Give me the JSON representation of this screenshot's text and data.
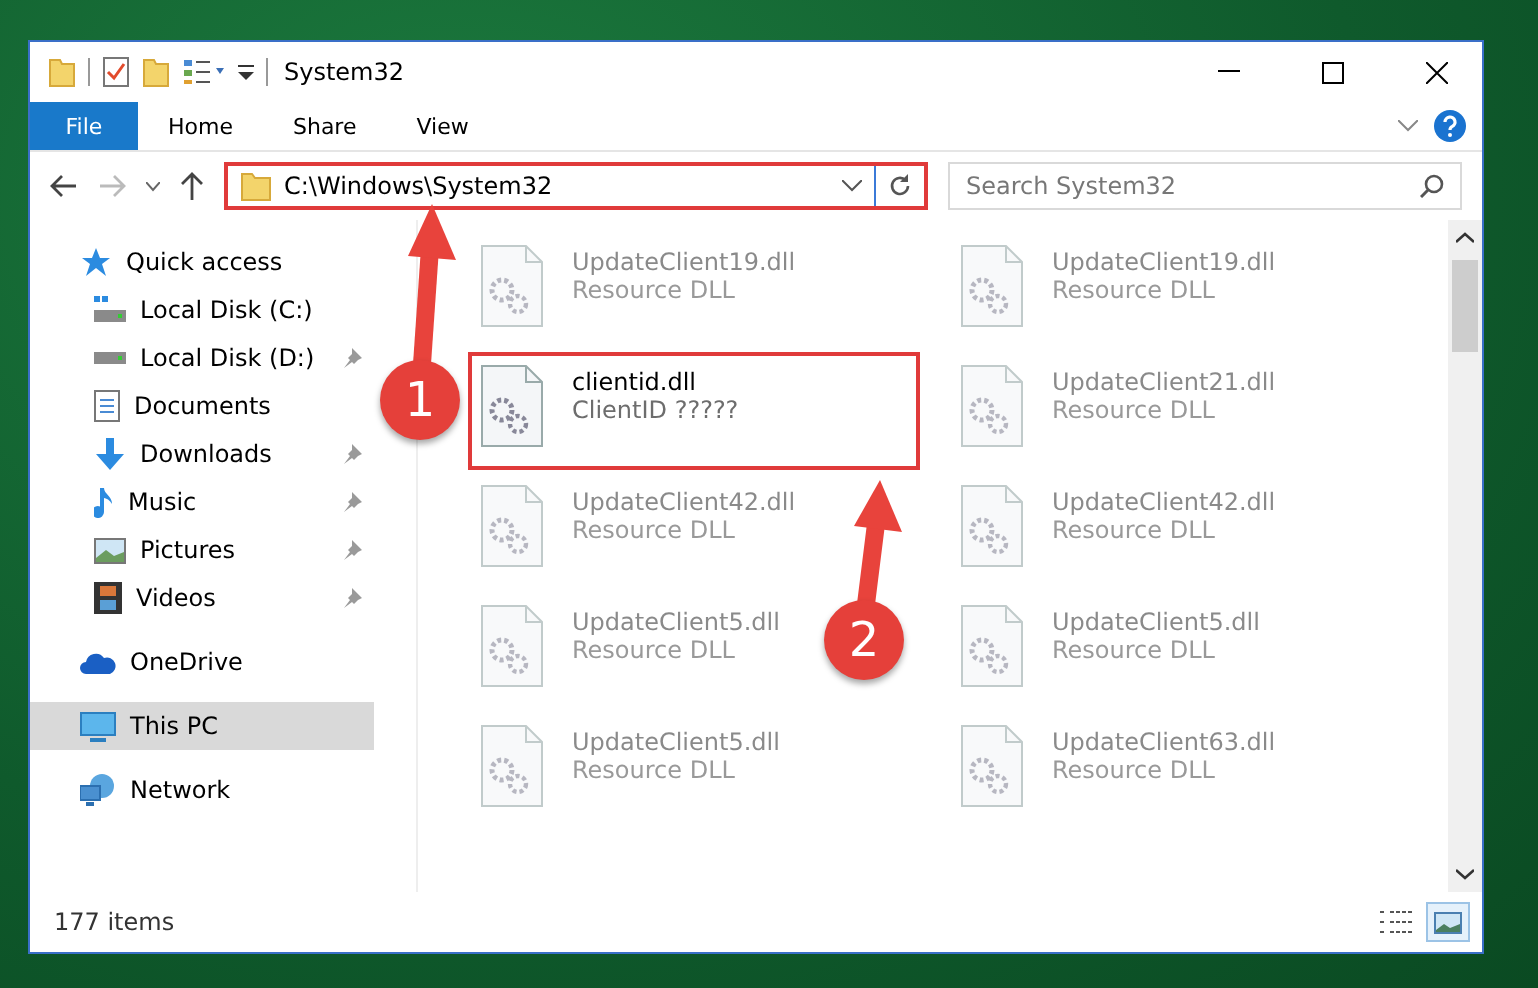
{
  "window": {
    "title": "System32"
  },
  "ribbon_tabs": [
    {
      "label": "File",
      "kind": "file",
      "selected": false
    },
    {
      "label": "Home",
      "kind": "tab",
      "selected": false
    },
    {
      "label": "Share",
      "kind": "tab",
      "selected": false
    },
    {
      "label": "View",
      "kind": "tab",
      "selected": false
    }
  ],
  "address_bar": {
    "path": "C:\\Windows\\System32",
    "highlighted": true
  },
  "search": {
    "placeholder": "Search System32"
  },
  "sidebar": {
    "items": [
      {
        "label": "Quick access",
        "kind": "star",
        "selected": false,
        "children": [
          {
            "label": "Local Disk (C:)",
            "kind": "drive-c",
            "pinned": false,
            "selected": false
          },
          {
            "label": "Local Disk (D:)",
            "kind": "drive",
            "pinned": true,
            "selected": false
          },
          {
            "label": "Documents",
            "kind": "documents",
            "pinned": false,
            "selected": false
          },
          {
            "label": "Downloads",
            "kind": "downloads",
            "pinned": true,
            "selected": false
          },
          {
            "label": "Music",
            "kind": "music",
            "pinned": true,
            "selected": false
          },
          {
            "label": "Pictures",
            "kind": "pictures",
            "pinned": true,
            "selected": false
          },
          {
            "label": "Videos",
            "kind": "videos",
            "pinned": true,
            "selected": false
          }
        ]
      },
      {
        "label": "OneDrive",
        "kind": "cloud",
        "selected": false
      },
      {
        "label": "This PC",
        "kind": "pc",
        "selected": true
      },
      {
        "label": "Network",
        "kind": "network",
        "selected": false
      }
    ]
  },
  "files": [
    {
      "name": "UpdateClient19.dll",
      "type": "Resource DLL",
      "blurred": true,
      "highlighted": false
    },
    {
      "name": "UpdateClient19.dll",
      "type": "Resource DLL",
      "blurred": true,
      "highlighted": false
    },
    {
      "name": "clientid.dll",
      "type": "ClientID ?????",
      "blurred": false,
      "highlighted": true
    },
    {
      "name": "UpdateClient21.dll",
      "type": "Resource DLL",
      "blurred": true,
      "highlighted": false
    },
    {
      "name": "UpdateClient42.dll",
      "type": "Resource DLL",
      "blurred": true,
      "highlighted": false
    },
    {
      "name": "UpdateClient42.dll",
      "type": "Resource DLL",
      "blurred": true,
      "highlighted": false
    },
    {
      "name": "UpdateClient5.dll",
      "type": "Resource DLL",
      "blurred": true,
      "highlighted": false
    },
    {
      "name": "UpdateClient5.dll",
      "type": "Resource DLL",
      "blurred": true,
      "highlighted": false
    },
    {
      "name": "UpdateClient5.dll",
      "type": "Resource DLL",
      "blurred": true,
      "highlighted": false
    },
    {
      "name": "UpdateClient63.dll",
      "type": "Resource DLL",
      "blurred": true,
      "highlighted": false
    }
  ],
  "status_bar": {
    "item_count": "177 items",
    "views": [
      {
        "kind": "details",
        "selected": false
      },
      {
        "kind": "large-icons",
        "selected": true
      }
    ]
  },
  "annotations": [
    {
      "number": "1"
    },
    {
      "number": "2"
    }
  ]
}
